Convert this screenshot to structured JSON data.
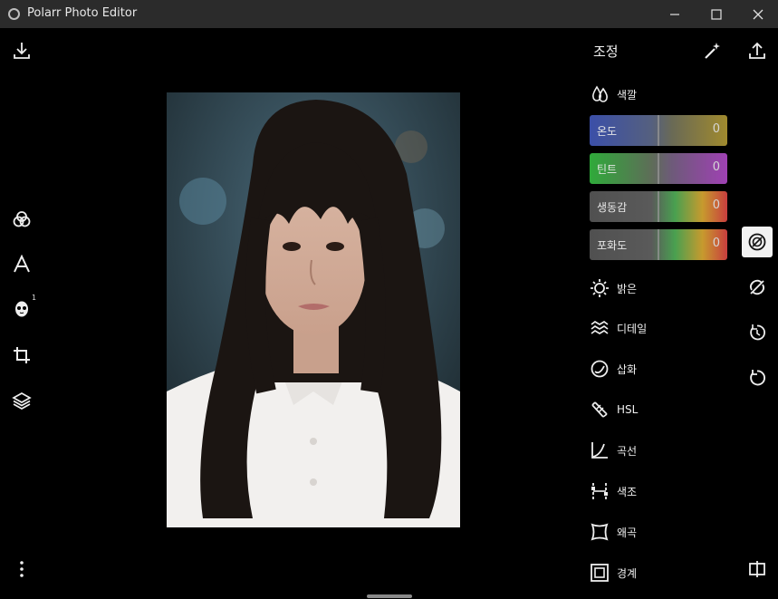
{
  "window": {
    "title": "Polarr Photo Editor",
    "minimize_icon": "minimize-icon",
    "maximize_icon": "maximize-icon",
    "close_icon": "close-icon"
  },
  "left_toolbar": {
    "items": [
      {
        "name": "download-icon"
      },
      {
        "name": "filters-icon"
      },
      {
        "name": "text-icon"
      },
      {
        "name": "face-icon",
        "badge": "1"
      },
      {
        "name": "crop-icon"
      },
      {
        "name": "layers-icon"
      },
      {
        "name": "more-icon"
      }
    ]
  },
  "panel": {
    "title": "조정",
    "sections": {
      "color": "색깔",
      "light": "밝은",
      "detail": "디테일",
      "vignette": "삽화",
      "hsl": "HSL",
      "curves": "곡선",
      "toning": "색조",
      "distortion": "왜곡",
      "border": "경계"
    },
    "sliders": [
      {
        "label": "온도",
        "value": "0"
      },
      {
        "label": "틴트",
        "value": "0"
      },
      {
        "label": "생동감",
        "value": "0"
      },
      {
        "label": "포화도",
        "value": "0"
      }
    ]
  },
  "right_toolbar": {
    "items": [
      "export-icon",
      "adjust-icon",
      "erase-icon",
      "history-icon",
      "reset-icon",
      "compare-icon"
    ]
  },
  "colors": {
    "titlebar": "#2b2b2b",
    "background": "#000000",
    "active_tool": "#f2f2f2"
  }
}
